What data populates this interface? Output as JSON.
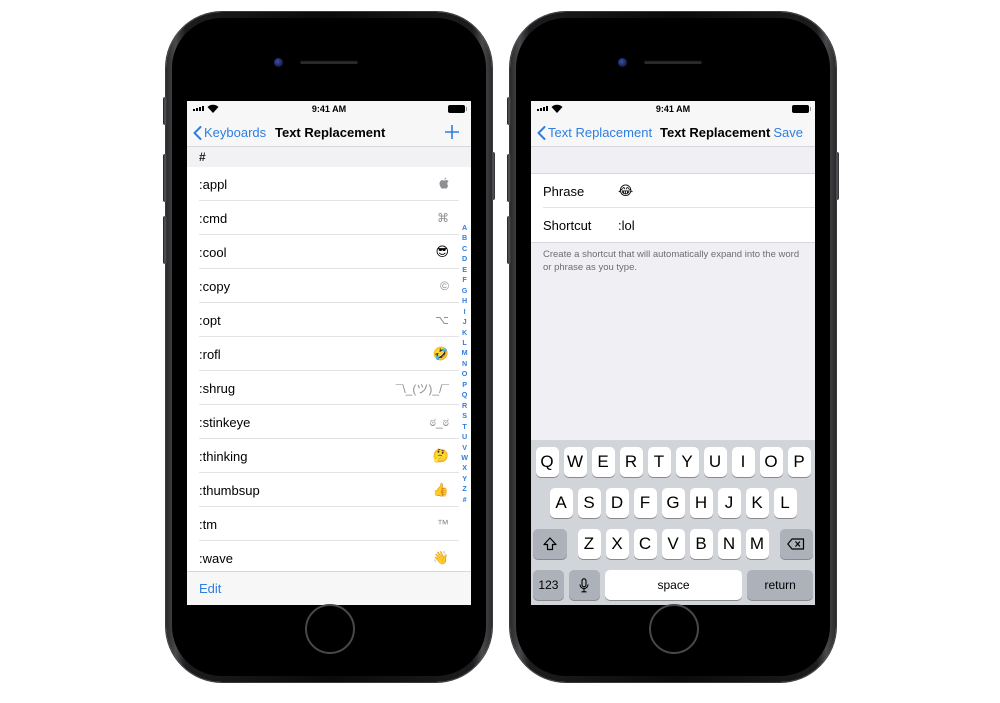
{
  "left_phone": {
    "status": {
      "time": "9:41 AM"
    },
    "nav": {
      "back_label": "Keyboards",
      "title": "Text Replacement",
      "add_icon": "plus-icon"
    },
    "section_header": "#",
    "rows": [
      {
        "shortcut": ":appl",
        "phrase": "",
        "phrase_icon": "apple-logo-icon",
        "emoji": false
      },
      {
        "shortcut": ":cmd",
        "phrase": "⌘",
        "emoji": false
      },
      {
        "shortcut": ":cool",
        "phrase": "😎",
        "emoji": true
      },
      {
        "shortcut": ":copy",
        "phrase": "©",
        "emoji": false
      },
      {
        "shortcut": ":opt",
        "phrase": "⌥",
        "emoji": false
      },
      {
        "shortcut": ":rofl",
        "phrase": "🤣",
        "emoji": true
      },
      {
        "shortcut": ":shrug",
        "phrase": "¯\\_(ツ)_/¯",
        "emoji": false
      },
      {
        "shortcut": ":stinkeye",
        "phrase": "ಠ_ಠ",
        "emoji": false
      },
      {
        "shortcut": ":thinking",
        "phrase": "🤔",
        "emoji": true
      },
      {
        "shortcut": ":thumbsup",
        "phrase": "👍",
        "emoji": true
      },
      {
        "shortcut": ":tm",
        "phrase": "™",
        "emoji": false
      },
      {
        "shortcut": ":wave",
        "phrase": "👋",
        "emoji": true
      }
    ],
    "index_letters": [
      "A",
      "B",
      "C",
      "D",
      "E",
      "F",
      "G",
      "H",
      "I",
      "J",
      "K",
      "L",
      "M",
      "N",
      "O",
      "P",
      "Q",
      "R",
      "S",
      "T",
      "U",
      "V",
      "W",
      "X",
      "Y",
      "Z",
      "#"
    ],
    "toolbar": {
      "edit_label": "Edit"
    }
  },
  "right_phone": {
    "status": {
      "time": "9:41 AM"
    },
    "nav": {
      "back_label": "Text Replacement",
      "title": "Text Replacement",
      "save_label": "Save"
    },
    "form": {
      "phrase_label": "Phrase",
      "phrase_value": "😂",
      "shortcut_label": "Shortcut",
      "shortcut_value": ":lol",
      "footer": "Create a shortcut that will automatically expand into the word or phrase as you type."
    },
    "keyboard": {
      "row1": [
        "Q",
        "W",
        "E",
        "R",
        "T",
        "Y",
        "U",
        "I",
        "O",
        "P"
      ],
      "row2": [
        "A",
        "S",
        "D",
        "F",
        "G",
        "H",
        "J",
        "K",
        "L"
      ],
      "row3": [
        "Z",
        "X",
        "C",
        "V",
        "B",
        "N",
        "M"
      ],
      "numbers_label": "123",
      "space_label": "space",
      "return_label": "return"
    }
  },
  "colors": {
    "accent": "#2f7ee0",
    "nav_bg": "#f7f7f7",
    "group_bg": "#efeff4",
    "keyboard_bg": "#d1d4d9"
  }
}
